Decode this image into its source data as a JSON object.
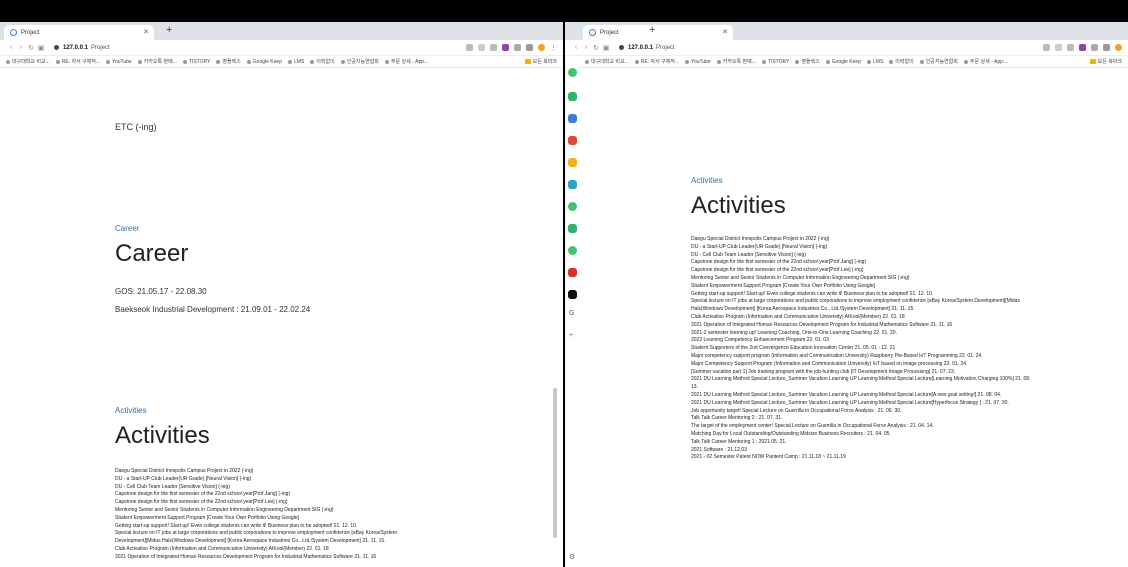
{
  "browser": {
    "tab_title": "Project",
    "url_host": "127.0.0.1",
    "url_path": "Project",
    "bookmarks": [
      "대구대학교 비교...",
      "RE: 자서 구체적...",
      "YouTube",
      "카카오톡 판매...",
      "TISTORY",
      "영플렉스",
      "Google Keep",
      "LMS",
      "이력없이",
      "인공지능연합회",
      "주문 상세 - App..."
    ],
    "bookmarks_folder": "모든 북마크"
  },
  "left": {
    "etc": "ETC (-ing)",
    "career_label": "Career",
    "career_title": "Career",
    "career_items": [
      "GOS: 21.05.17 - 22.08.30",
      "Baekseok Industrial Development : 21.09.01 - 22.02.24"
    ],
    "activities_label": "Activities",
    "activities_title": "Activities",
    "activities": [
      "Daegu Special District Innopolis Campus Project in 2022 (-ing)",
      "DU - a Start-UP Club Leader(UR Grade) [Neural Vision] (-ing)",
      "DU - Cell Club Team Leader [Sensitive Vision] (-ing)",
      "Capstone design for the first semester of the 22nd school year[Prof.Jang] (-ing)",
      "Capstone design for the first semester of the 22nd school year[Prof.Lee] (-ing)",
      "Mentoring Senior and Senior Students in Computer Information Engineering Department SIG (-ing)",
      "Student Empowerment Support Program [Create Your Own Portfolio Using Google]",
      "Getting start-up support! Start-up! Even college students can write it! Business plan to be adopted! 21. 12. 10.",
      "Special lecture on IT jobs at large corporations and public corporations to improve employment confidence [eBay Korea/System Development][Midas Hals(Windows Development] [Korea Aerospace Industries Co., Ltd./System Development] 21. 11. 15.",
      "Club Activation Program (Information and Communication University) AIKool(Member) 22. 01. 18",
      "2021 Operation of Integrated Human Resources Development Program for Industrial Mathematics Software 21. 11. 16"
    ]
  },
  "right": {
    "activities_label": "Activities",
    "activities_title": "Activities",
    "activities": [
      "Daegu Special District Innopolis Campus Project in 2022 (-ing)",
      "DU - a Start-UP Club Leader(UR Grade) [Neural Vision] (-ing)",
      "DU - Cell Club Team Leader [Sensitive Vision] (-ing)",
      "Capstone design for the first semester of the 22nd school year[Prof.Jang] (-ing)",
      "Capstone design for the first semester of the 22nd school year[Prof.Lee] (-ing)",
      "Mentoring Senior and Senior Students in Computer Information Engineering Department SIG (-ing)",
      "Student Empowerment Support Program [Create Your Own Portfolio Using Google]",
      "Getting start-up support! Start-up! Even college students can write it! Business plan to be adopted! 21. 12. 10.",
      "Special lecture on IT jobs at large corporations and public corporations to improve employment confidence [eBay Korea/System Development][Midas Hals(Windows Development] [Korea Aerospace Industries Co., Ltd./System Development] 21. 11. 15.",
      "Club Activation Program (Information and Communication University) AIKool(Member) 22. 01. 18",
      "2021 Operation of Integrated Human Resources Development Program for Industrial Mathematics Software 21. 11. 16",
      "2021-2 semester learning up! Learning Coaching, One-to-One Learning Coaching 22. 01. 20.",
      "2022 Learning Competency Enhancement Program 22. 01. 03",
      "Student Supporters of the 2nd Convergence Education Innovation Center 21. 05. 01 - 12. 21",
      "Major competency support program (Information and Communication University) Raspberry Pie-Based IoT Programming 22. 01. 24.",
      "Major Competency Support Program (Information and Communication University) IoT based on image processing 22. 01. 24.",
      "[Summer vacation part 1] Job training program with the job-hunting club [IT Development Image Processing] 21. 07. 23.",
      "2021 DU Learning Method Special Lecture_Summer Vacation Learning UP Learning Method Special Lecture[Learning Motivation Charging 100%] 21. 08. 13.",
      "2021 DU Learning Method Special Lecture_Summer Vacation Learning UP Learning Method Special Lecture[A new goal setting!] 21. 08. 04.",
      "2021 DU Learning Method Special Lecture_Summer Vacation Learning UP Learning Method Special Lecture[Hyperfocus Strategy ] : 21. 07. 30.",
      "Job opportunity target! Special Lecture on Guerrilla in Occupational Force Analysis : 21. 06. 30.",
      "Talk Talk Career Mentoring 2 : 21. 07. 31.",
      "The target of the employment center! Special Lecture on Guerrilla in Occupational Force Analysis : 21. 04. 14.",
      "Matching Day for Local Outstanding/Outstanding Midsize Business Recruiters : 21. 04. 05.",
      "Talk Talk Career Mentoring 1 : 2021 05. 21.",
      "2021 Software : 21.12.03",
      "2021 - 02 Semester Patent NOW Pantent Camp : 21.11.18 ~ 21.11.19"
    ]
  },
  "colors": {
    "accent": "#2f6ea8",
    "tabbar": "#dee1e6"
  }
}
